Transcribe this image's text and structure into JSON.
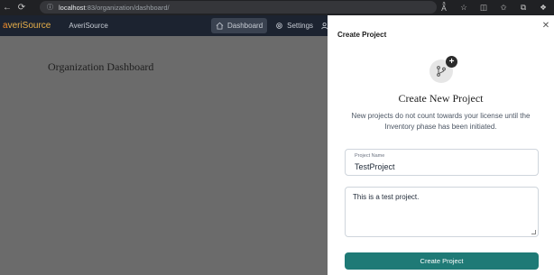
{
  "browser": {
    "url_host": "localhost",
    "url_path": ":83/organization/dashboard/"
  },
  "header": {
    "logo_prefix": "a",
    "logo_rest": "veriSource",
    "org_name": "AveriSource",
    "nav": [
      {
        "label": "Dashboard",
        "icon": "home-icon",
        "active": true
      },
      {
        "label": "Settings",
        "icon": "gear-icon",
        "active": false
      },
      {
        "label": "",
        "icon": "users-icon",
        "active": false
      }
    ]
  },
  "page": {
    "title": "Organization Dashboard"
  },
  "drawer": {
    "title": "Create Project",
    "heading": "Create New Project",
    "info_text": "New projects do not count towards your license until the Inventory phase has been initiated.",
    "project_name_label": "Project Name",
    "project_name_value": "TestProject",
    "description_value": "This is a test project.",
    "submit_label": "Create Project"
  },
  "colors": {
    "accent": "#1f7a76",
    "header_bg": "#1c2330",
    "logo": "#e8b04a"
  }
}
